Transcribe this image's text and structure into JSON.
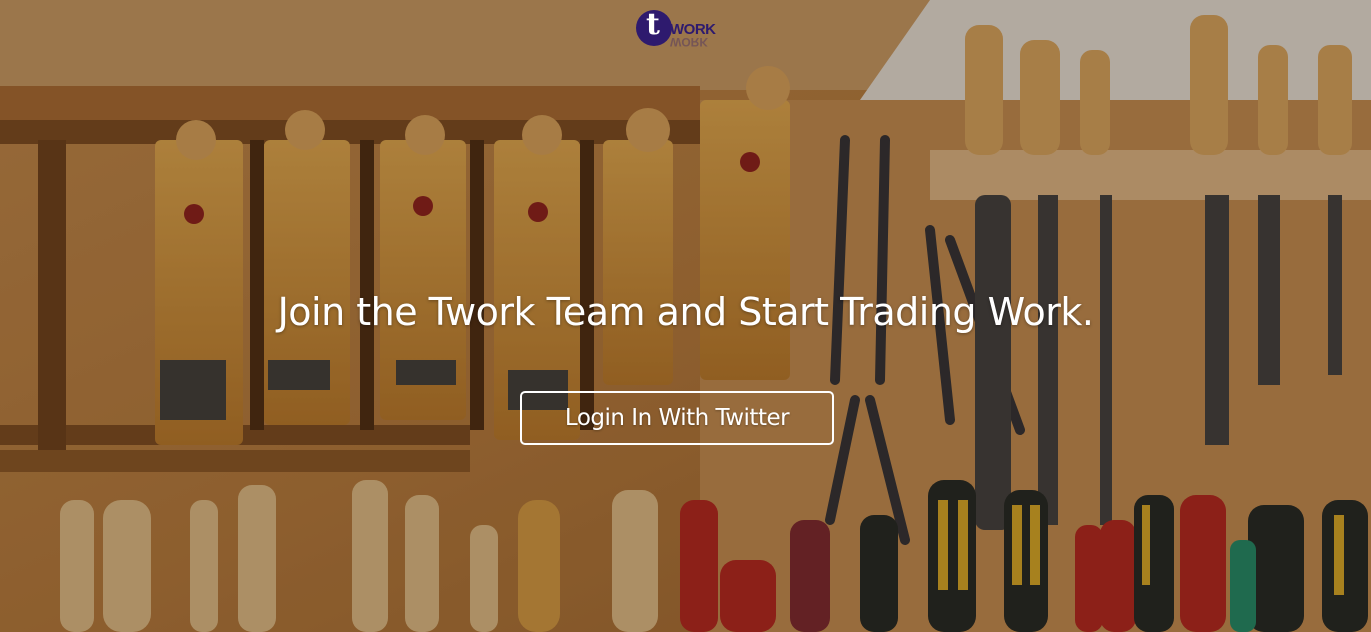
{
  "logo": {
    "mark": "t",
    "wordmark": "WORK"
  },
  "hero": {
    "headline": "Join the Twork Team and Start Trading Work.",
    "cta_label": "Login In With Twitter",
    "background_description_icon": "workshop-tools-photo"
  },
  "colors": {
    "brand": "#2e1a6e",
    "text": "#ffffff",
    "wood": "#b77a3c"
  }
}
